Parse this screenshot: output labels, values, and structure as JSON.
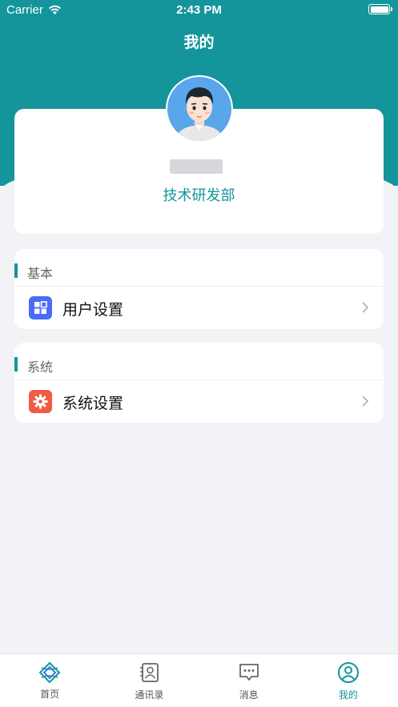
{
  "status_bar": {
    "carrier": "Carrier",
    "time": "2:43 PM"
  },
  "nav": {
    "title": "我的"
  },
  "profile": {
    "department": "技术研发部"
  },
  "sections": [
    {
      "label": "基本",
      "items": [
        {
          "label": "用户设置",
          "icon": "grid-icon",
          "icon_color": "#4a6cf7"
        }
      ]
    },
    {
      "label": "系统",
      "items": [
        {
          "label": "系统设置",
          "icon": "gear-icon",
          "icon_color": "#ef5b45"
        }
      ]
    }
  ],
  "tabs": [
    {
      "label": "首页",
      "icon": "home-logo-icon",
      "active": false
    },
    {
      "label": "通讯录",
      "icon": "contacts-icon",
      "active": false
    },
    {
      "label": "消息",
      "icon": "message-icon",
      "active": false
    },
    {
      "label": "我的",
      "icon": "profile-icon",
      "active": true
    }
  ],
  "colors": {
    "primary": "#13959b",
    "background": "#f2f3f7",
    "tab_inactive": "#555555"
  }
}
